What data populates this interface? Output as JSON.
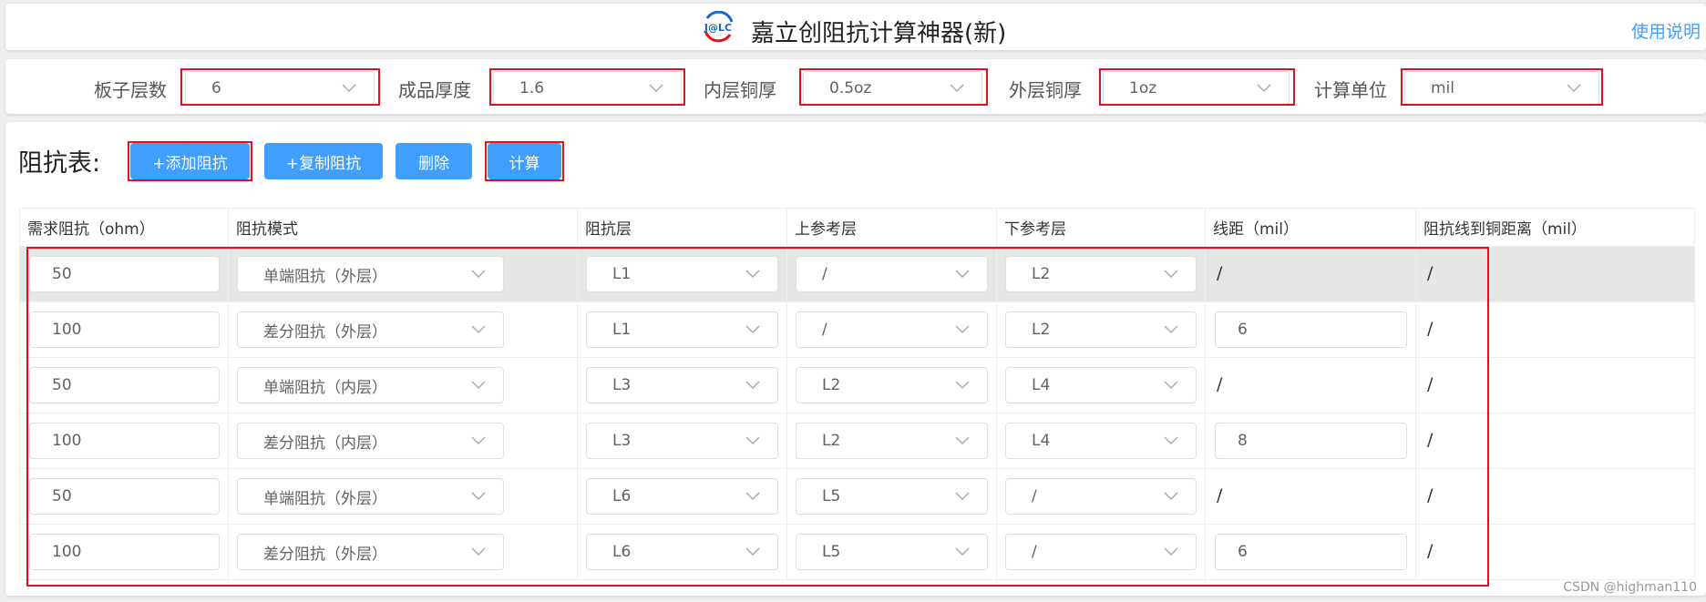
{
  "header": {
    "title": "嘉立创阻抗计算神器(新)",
    "logo_text": "J@LC",
    "help_link": "使用说明"
  },
  "settings": [
    {
      "label": "板子层数",
      "value": "6"
    },
    {
      "label": "成品厚度",
      "value": "1.6"
    },
    {
      "label": "内层铜厚",
      "value": "0.5oz"
    },
    {
      "label": "外层铜厚",
      "value": "1oz"
    },
    {
      "label": "计算单位",
      "value": "mil"
    }
  ],
  "toolbar": {
    "title": "阻抗表:",
    "add_label": "+添加阻抗",
    "copy_label": "+复制阻抗",
    "delete_label": "删除",
    "calc_label": "计算"
  },
  "table": {
    "headers": [
      "需求阻抗（ohm）",
      "阻抗模式",
      "阻抗层",
      "上参考层",
      "下参考层",
      "线距（mil）",
      "阻抗线到铜距离（mil）"
    ],
    "rows": [
      {
        "impedance": "50",
        "mode": "单端阻抗（外层）",
        "layer": "L1",
        "upper_ref": "/",
        "lower_ref": "L2",
        "spacing": "/",
        "copper_dist": "/"
      },
      {
        "impedance": "100",
        "mode": "差分阻抗（外层）",
        "layer": "L1",
        "upper_ref": "/",
        "lower_ref": "L2",
        "spacing": "6",
        "copper_dist": "/"
      },
      {
        "impedance": "50",
        "mode": "单端阻抗（内层）",
        "layer": "L3",
        "upper_ref": "L2",
        "lower_ref": "L4",
        "spacing": "/",
        "copper_dist": "/"
      },
      {
        "impedance": "100",
        "mode": "差分阻抗（内层）",
        "layer": "L3",
        "upper_ref": "L2",
        "lower_ref": "L4",
        "spacing": "8",
        "copper_dist": "/"
      },
      {
        "impedance": "50",
        "mode": "单端阻抗（外层）",
        "layer": "L6",
        "upper_ref": "L5",
        "lower_ref": "/",
        "spacing": "/",
        "copper_dist": "/"
      },
      {
        "impedance": "100",
        "mode": "差分阻抗（外层）",
        "layer": "L6",
        "upper_ref": "L5",
        "lower_ref": "/",
        "spacing": "6",
        "copper_dist": "/"
      }
    ]
  },
  "watermark": "CSDN @highman110",
  "colors": {
    "accent": "#409eff",
    "highlight_box": "#e5101d",
    "selected_row": "#e6e6e6"
  }
}
